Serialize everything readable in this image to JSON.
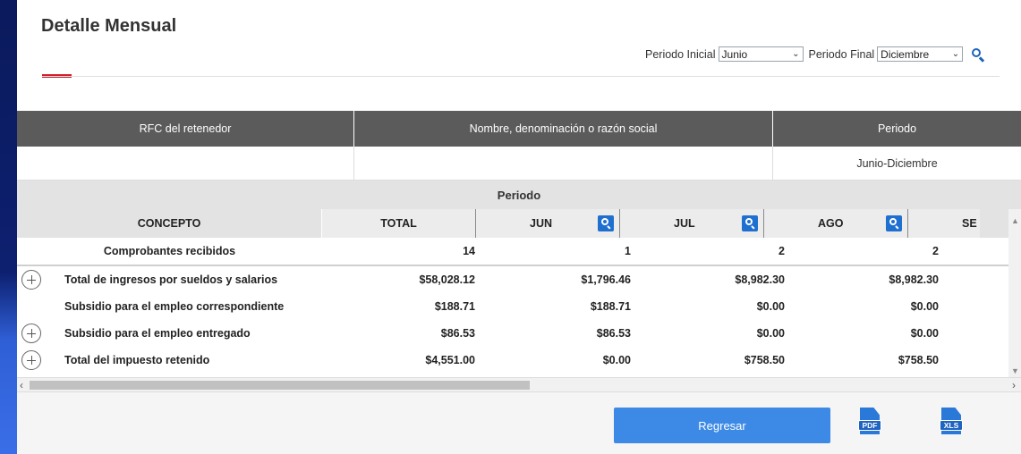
{
  "page": {
    "title": "Detalle Mensual"
  },
  "filters": {
    "start_label": "Periodo Inicial",
    "start_value": "Junio",
    "end_label": "Periodo Final",
    "end_value": "Diciembre"
  },
  "summary": {
    "headers": [
      "RFC del retenedor",
      "Nombre, denominación o razón social",
      "Periodo"
    ],
    "values": [
      "",
      "",
      "Junio-Diciembre"
    ]
  },
  "detail": {
    "period_label": "Periodo",
    "columns": [
      "CONCEPTO",
      "TOTAL",
      "JUN",
      "JUL",
      "AGO",
      "SE"
    ],
    "rows": [
      {
        "label": "Comprobantes recibidos",
        "values": [
          "14",
          "1",
          "2",
          "2"
        ]
      },
      {
        "label": "Total de ingresos por sueldos y salarios",
        "values": [
          "$58,028.12",
          "$1,796.46",
          "$8,982.30",
          "$8,982.30"
        ]
      },
      {
        "label": "Subsidio para el empleo correspondiente",
        "values": [
          "$188.71",
          "$188.71",
          "$0.00",
          "$0.00"
        ]
      },
      {
        "label": "Subsidio para el empleo entregado",
        "values": [
          "$86.53",
          "$86.53",
          "$0.00",
          "$0.00"
        ]
      },
      {
        "label": "Total del impuesto retenido",
        "values": [
          "$4,551.00",
          "$0.00",
          "$758.50",
          "$758.50"
        ]
      }
    ]
  },
  "footer": {
    "back_label": "Regresar",
    "pdf_label": "PDF",
    "xls_label": "XLS"
  },
  "colors": {
    "accent": "#d01e2c",
    "primary": "#3d8ae6",
    "header_bg": "#5b5b5b",
    "frame": "#0b1a5c"
  },
  "icons": [
    "search-icon",
    "chevron-down-icon",
    "plus-circle-icon",
    "pdf-file-icon",
    "xls-file-icon"
  ]
}
